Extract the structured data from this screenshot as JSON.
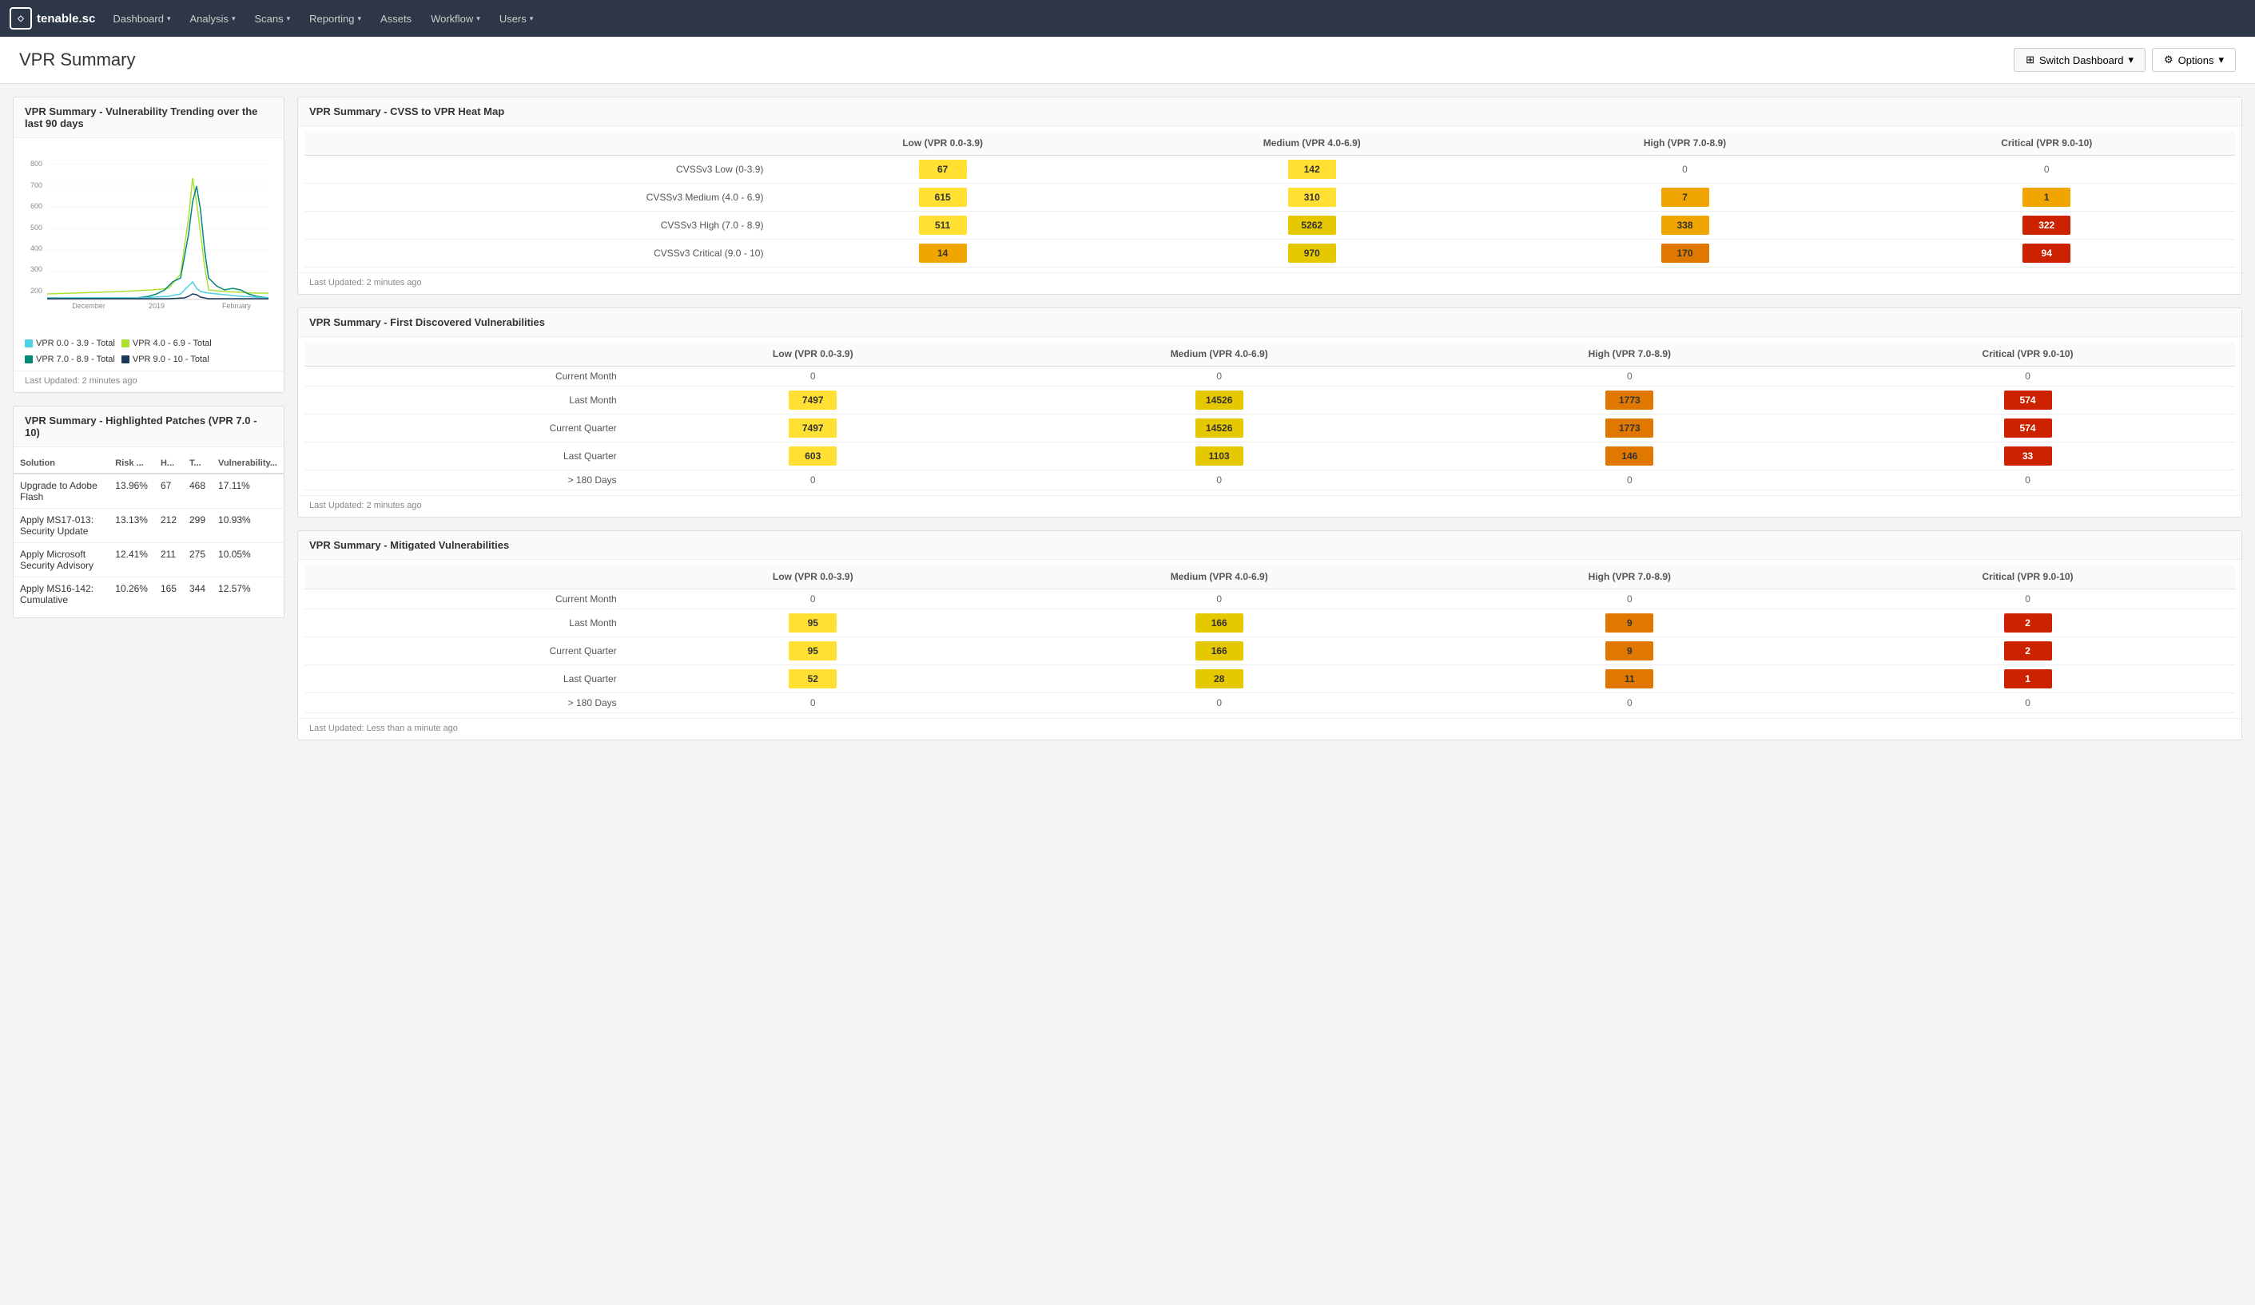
{
  "brand": {
    "name": "tenable.sc",
    "icon_text": "T"
  },
  "nav": {
    "items": [
      {
        "label": "Dashboard",
        "has_dropdown": true
      },
      {
        "label": "Analysis",
        "has_dropdown": true
      },
      {
        "label": "Scans",
        "has_dropdown": true
      },
      {
        "label": "Reporting",
        "has_dropdown": true
      },
      {
        "label": "Assets",
        "has_dropdown": false
      },
      {
        "label": "Workflow",
        "has_dropdown": true
      },
      {
        "label": "Users",
        "has_dropdown": true
      }
    ]
  },
  "page": {
    "title": "VPR Summary",
    "switch_dashboard_label": "Switch Dashboard",
    "options_label": "Options"
  },
  "vulnerability_trend": {
    "title": "VPR Summary - Vulnerability Trending over the last 90 days",
    "last_updated": "Last Updated: 2 minutes ago",
    "legend": [
      {
        "label": "VPR 0.0 - 3.9 - Total",
        "color": "#4dd0e1"
      },
      {
        "label": "VPR 4.0 - 6.9 - Total",
        "color": "#aee033"
      },
      {
        "label": "VPR 7.0 - 8.9 - Total",
        "color": "#00897b"
      },
      {
        "label": "VPR 9.0 - 10 - Total",
        "color": "#1a3a5c"
      }
    ]
  },
  "highlighted_patches": {
    "title": "VPR Summary - Highlighted Patches (VPR 7.0 - 10)",
    "columns": [
      "Solution",
      "Risk ...",
      "H...",
      "T...",
      "Vulnerability..."
    ],
    "rows": [
      {
        "solution": "Upgrade to Adobe Flash",
        "risk": "13.96%",
        "h": "67",
        "t": "468",
        "vuln": "17.11%"
      },
      {
        "solution": "Apply MS17-013: Security Update",
        "risk": "13.13%",
        "h": "212",
        "t": "299",
        "vuln": "10.93%"
      },
      {
        "solution": "Apply Microsoft Security Advisory",
        "risk": "12.41%",
        "h": "211",
        "t": "275",
        "vuln": "10.05%"
      },
      {
        "solution": "Apply MS16-142: Cumulative",
        "risk": "10.26%",
        "h": "165",
        "t": "344",
        "vuln": "12.57%"
      }
    ]
  },
  "cvss_heatmap": {
    "title": "VPR Summary - CVSS to VPR Heat Map",
    "col_headers": [
      "Low (VPR 0.0-3.9)",
      "Medium (VPR 4.0-6.9)",
      "High (VPR 7.0-8.9)",
      "Critical (VPR 9.0-10)"
    ],
    "rows": [
      {
        "label": "CVSSv3 Low (0-3.9)",
        "values": [
          {
            "val": "67",
            "style": "heat-yellow"
          },
          {
            "val": "142",
            "style": "heat-yellow"
          },
          {
            "val": "0",
            "style": "heat-zero"
          },
          {
            "val": "0",
            "style": "heat-zero"
          }
        ]
      },
      {
        "label": "CVSSv3 Medium (4.0 - 6.9)",
        "values": [
          {
            "val": "615",
            "style": "heat-yellow"
          },
          {
            "val": "310",
            "style": "heat-yellow"
          },
          {
            "val": "7",
            "style": "heat-orange"
          },
          {
            "val": "1",
            "style": "heat-orange"
          }
        ]
      },
      {
        "label": "CVSSv3 High (7.0 - 8.9)",
        "values": [
          {
            "val": "511",
            "style": "heat-yellow"
          },
          {
            "val": "5262",
            "style": "heat-yellow-med"
          },
          {
            "val": "338",
            "style": "heat-orange"
          },
          {
            "val": "322",
            "style": "heat-red"
          }
        ]
      },
      {
        "label": "CVSSv3 Critical (9.0 - 10)",
        "values": [
          {
            "val": "14",
            "style": "heat-orange"
          },
          {
            "val": "970",
            "style": "heat-yellow-med"
          },
          {
            "val": "170",
            "style": "heat-orange-dark"
          },
          {
            "val": "94",
            "style": "heat-red"
          }
        ]
      }
    ],
    "last_updated": "Last Updated: 2 minutes ago"
  },
  "first_discovered": {
    "title": "VPR Summary - First Discovered Vulnerabilities",
    "col_headers": [
      "Low (VPR 0.0-3.9)",
      "Medium (VPR 4.0-6.9)",
      "High (VPR 7.0-8.9)",
      "Critical (VPR 9.0-10)"
    ],
    "rows": [
      {
        "label": "Current Month",
        "values": [
          {
            "val": "0",
            "style": "heat-zero"
          },
          {
            "val": "0",
            "style": "heat-zero"
          },
          {
            "val": "0",
            "style": "heat-zero"
          },
          {
            "val": "0",
            "style": "heat-zero"
          }
        ]
      },
      {
        "label": "Last Month",
        "values": [
          {
            "val": "7497",
            "style": "heat-yellow"
          },
          {
            "val": "14526",
            "style": "heat-yellow-med"
          },
          {
            "val": "1773",
            "style": "heat-orange-dark"
          },
          {
            "val": "574",
            "style": "heat-red"
          }
        ]
      },
      {
        "label": "Current Quarter",
        "values": [
          {
            "val": "7497",
            "style": "heat-yellow"
          },
          {
            "val": "14526",
            "style": "heat-yellow-med"
          },
          {
            "val": "1773",
            "style": "heat-orange-dark"
          },
          {
            "val": "574",
            "style": "heat-red"
          }
        ]
      },
      {
        "label": "Last Quarter",
        "values": [
          {
            "val": "603",
            "style": "heat-yellow"
          },
          {
            "val": "1103",
            "style": "heat-yellow-med"
          },
          {
            "val": "146",
            "style": "heat-orange-dark"
          },
          {
            "val": "33",
            "style": "heat-red"
          }
        ]
      },
      {
        "label": "> 180 Days",
        "values": [
          {
            "val": "0",
            "style": "heat-zero"
          },
          {
            "val": "0",
            "style": "heat-zero"
          },
          {
            "val": "0",
            "style": "heat-zero"
          },
          {
            "val": "0",
            "style": "heat-zero"
          }
        ]
      }
    ],
    "last_updated": "Last Updated: 2 minutes ago"
  },
  "mitigated_vulnerabilities": {
    "title": "VPR Summary - Mitigated Vulnerabilities",
    "col_headers": [
      "Low (VPR 0.0-3.9)",
      "Medium (VPR 4.0-6.9)",
      "High (VPR 7.0-8.9)",
      "Critical (VPR 9.0-10)"
    ],
    "rows": [
      {
        "label": "Current Month",
        "values": [
          {
            "val": "0",
            "style": "heat-zero"
          },
          {
            "val": "0",
            "style": "heat-zero"
          },
          {
            "val": "0",
            "style": "heat-zero"
          },
          {
            "val": "0",
            "style": "heat-zero"
          }
        ]
      },
      {
        "label": "Last Month",
        "values": [
          {
            "val": "95",
            "style": "heat-yellow"
          },
          {
            "val": "166",
            "style": "heat-yellow-med"
          },
          {
            "val": "9",
            "style": "heat-orange-dark"
          },
          {
            "val": "2",
            "style": "heat-red"
          }
        ]
      },
      {
        "label": "Current Quarter",
        "values": [
          {
            "val": "95",
            "style": "heat-yellow"
          },
          {
            "val": "166",
            "style": "heat-yellow-med"
          },
          {
            "val": "9",
            "style": "heat-orange-dark"
          },
          {
            "val": "2",
            "style": "heat-red"
          }
        ]
      },
      {
        "label": "Last Quarter",
        "values": [
          {
            "val": "52",
            "style": "heat-yellow"
          },
          {
            "val": "28",
            "style": "heat-yellow-med"
          },
          {
            "val": "11",
            "style": "heat-orange-dark"
          },
          {
            "val": "1",
            "style": "heat-red"
          }
        ]
      },
      {
        "label": "> 180 Days",
        "values": [
          {
            "val": "0",
            "style": "heat-zero"
          },
          {
            "val": "0",
            "style": "heat-zero"
          },
          {
            "val": "0",
            "style": "heat-zero"
          },
          {
            "val": "0",
            "style": "heat-zero"
          }
        ]
      }
    ],
    "last_updated": "Last Updated: Less than a minute ago"
  }
}
